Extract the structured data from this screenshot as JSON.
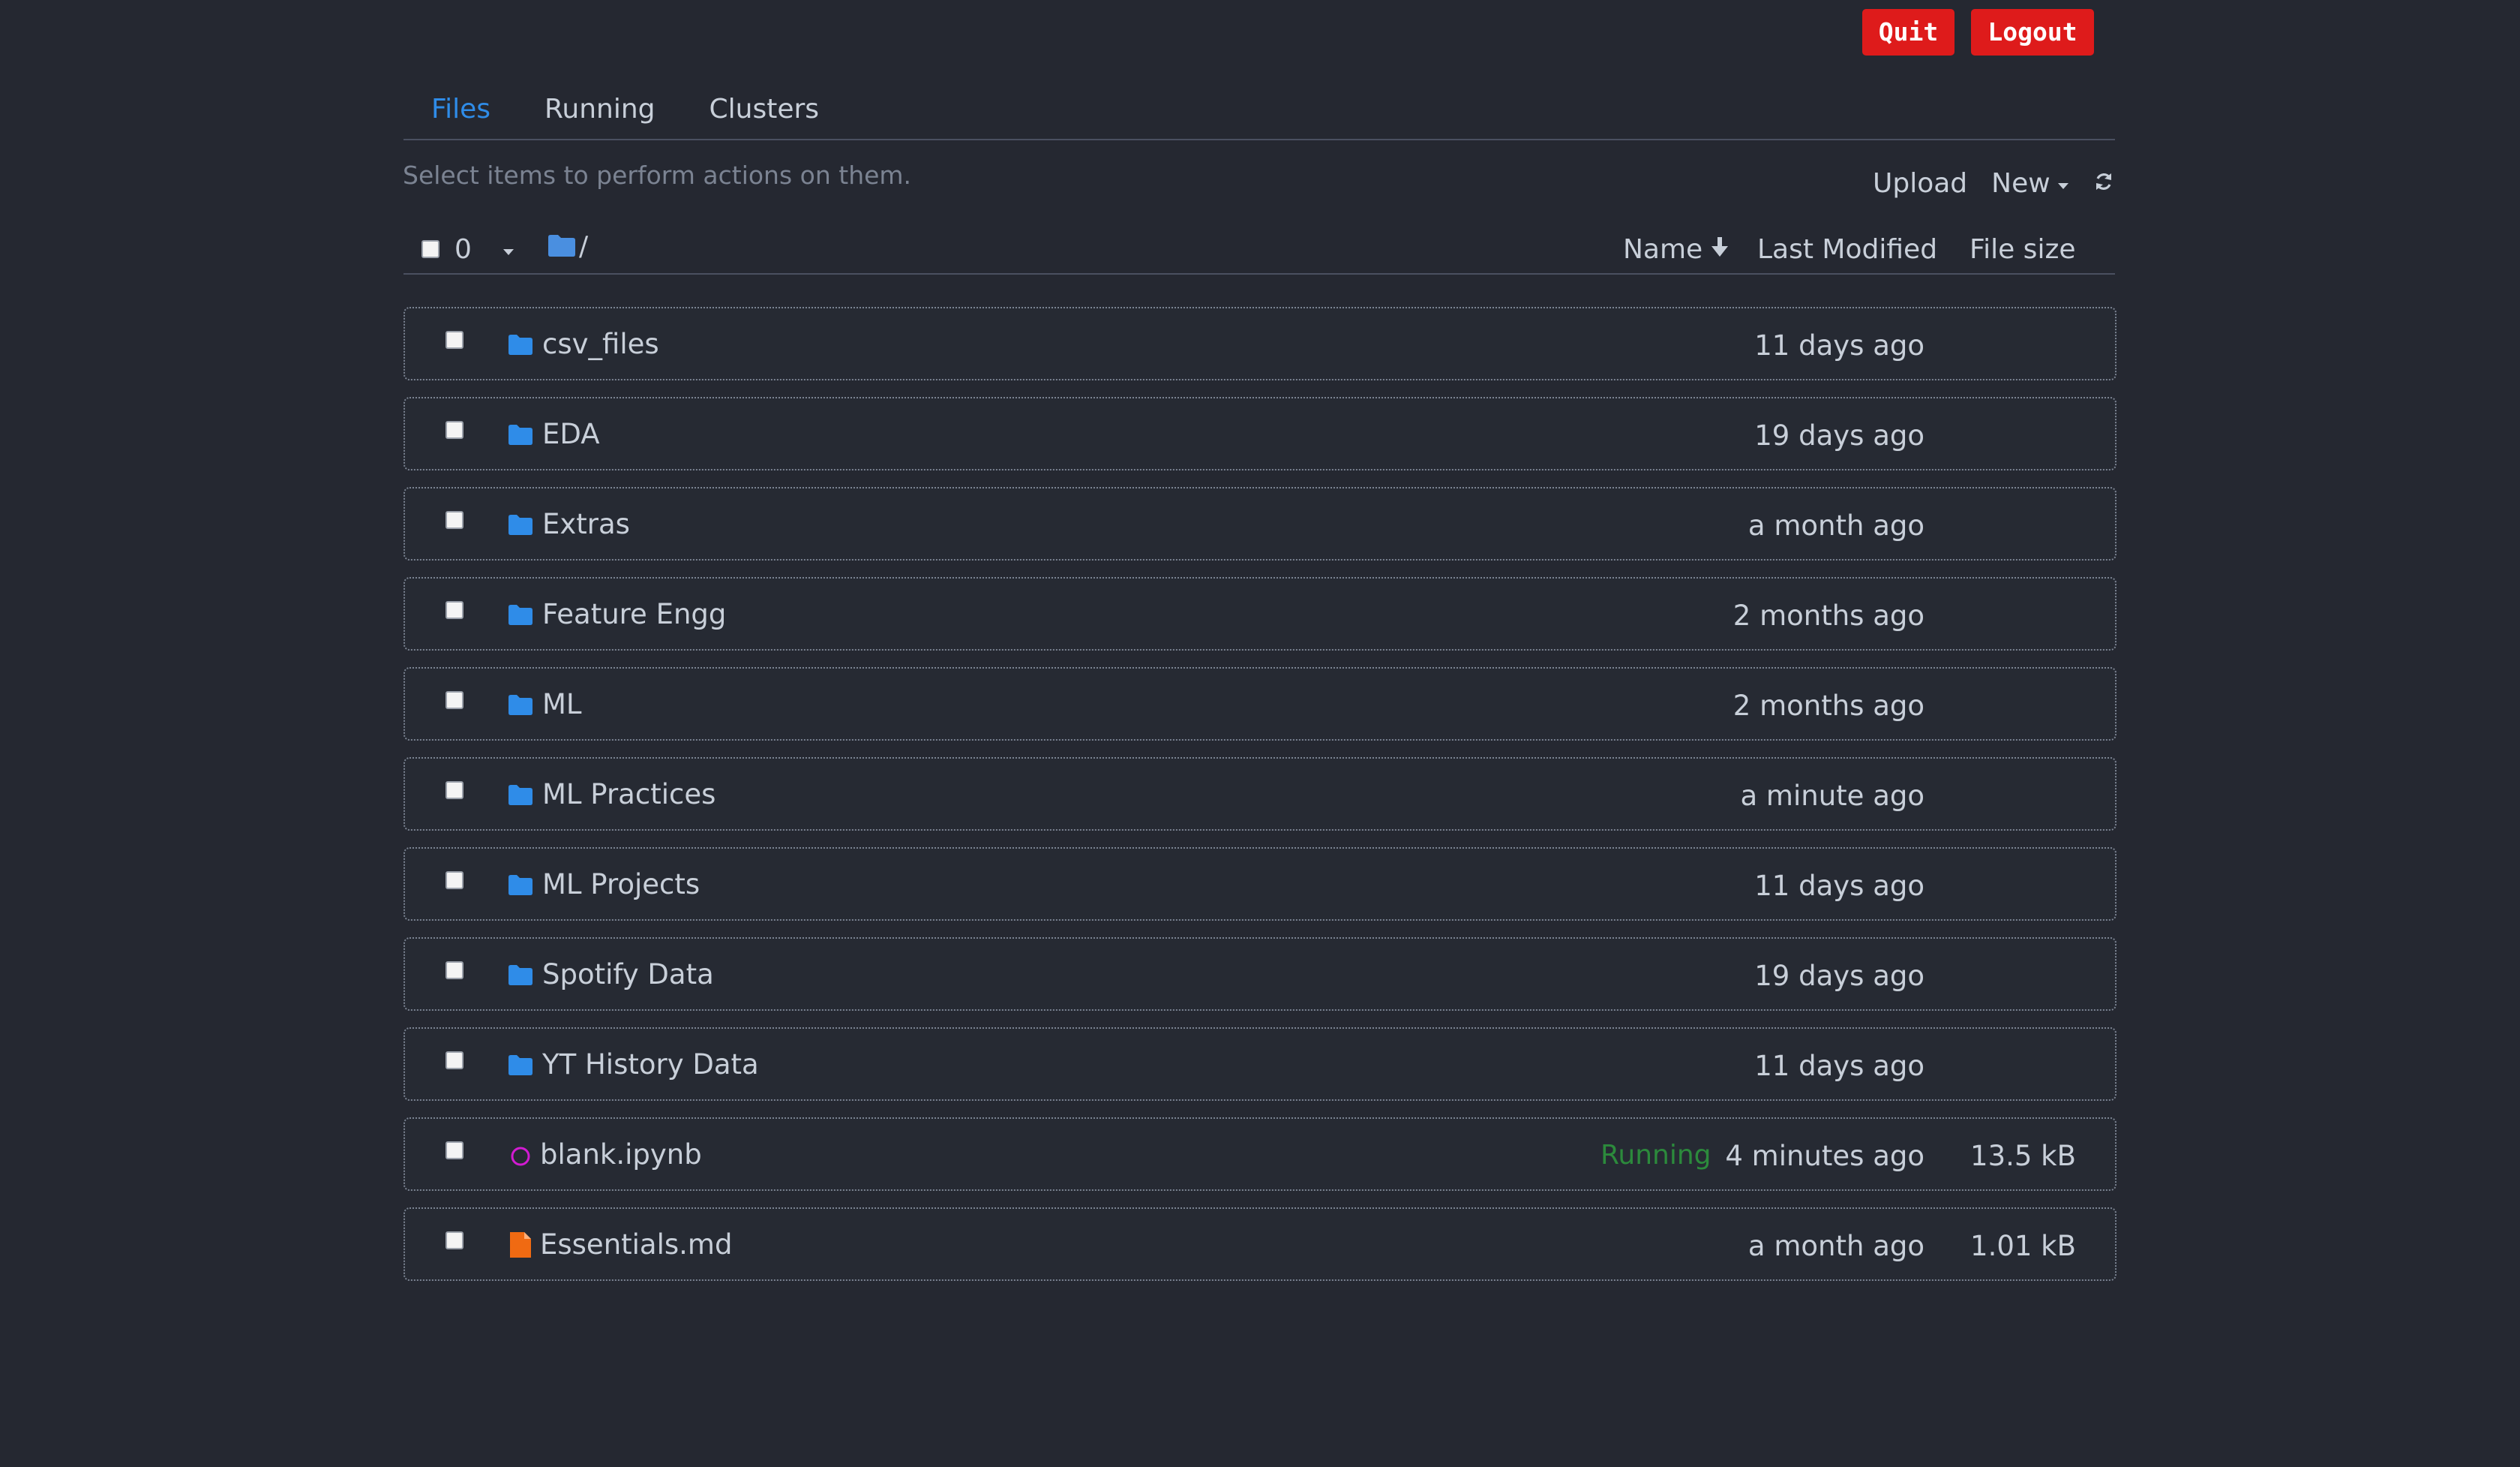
{
  "header": {
    "quit_label": "Quit",
    "logout_label": "Logout"
  },
  "tabs": [
    {
      "label": "Files",
      "active": true
    },
    {
      "label": "Running",
      "active": false
    },
    {
      "label": "Clusters",
      "active": false
    }
  ],
  "toolbar": {
    "hint": "Select items to perform actions on them.",
    "upload_label": "Upload",
    "new_label": "New",
    "refresh_icon": "refresh-icon"
  },
  "list_header": {
    "selected_count": "0",
    "breadcrumb": "/",
    "col_name": "Name",
    "col_modified": "Last Modified",
    "col_size": "File size"
  },
  "colors": {
    "background": "#252831",
    "accent": "#2f8ce8",
    "folder": "#2f8ce8",
    "quit_logout": "#de1b1b",
    "running_status": "#2c8a3c",
    "notebook_running": "#d21bd2",
    "markdown_file": "#f06a12"
  },
  "files": [
    {
      "type": "folder",
      "icon": "folder-icon",
      "name": "csv_files",
      "status": "",
      "modified": "11 days ago",
      "size": ""
    },
    {
      "type": "folder",
      "icon": "folder-icon",
      "name": "EDA",
      "status": "",
      "modified": "19 days ago",
      "size": ""
    },
    {
      "type": "folder",
      "icon": "folder-icon",
      "name": "Extras",
      "status": "",
      "modified": "a month ago",
      "size": ""
    },
    {
      "type": "folder",
      "icon": "folder-icon",
      "name": "Feature Engg",
      "status": "",
      "modified": "2 months ago",
      "size": ""
    },
    {
      "type": "folder",
      "icon": "folder-icon",
      "name": "ML",
      "status": "",
      "modified": "2 months ago",
      "size": ""
    },
    {
      "type": "folder",
      "icon": "folder-icon",
      "name": "ML Practices",
      "status": "",
      "modified": "a minute ago",
      "size": ""
    },
    {
      "type": "folder",
      "icon": "folder-icon",
      "name": "ML Projects",
      "status": "",
      "modified": "11 days ago",
      "size": ""
    },
    {
      "type": "folder",
      "icon": "folder-icon",
      "name": "Spotify Data",
      "status": "",
      "modified": "19 days ago",
      "size": ""
    },
    {
      "type": "folder",
      "icon": "folder-icon",
      "name": "YT History Data",
      "status": "",
      "modified": "11 days ago",
      "size": ""
    },
    {
      "type": "notebook",
      "icon": "running-notebook-icon",
      "name": "blank.ipynb",
      "status": "Running",
      "modified": "4 minutes ago",
      "size": "13.5 kB"
    },
    {
      "type": "markdown",
      "icon": "file-icon",
      "name": "Essentials.md",
      "status": "",
      "modified": "a month ago",
      "size": "1.01 kB"
    }
  ]
}
